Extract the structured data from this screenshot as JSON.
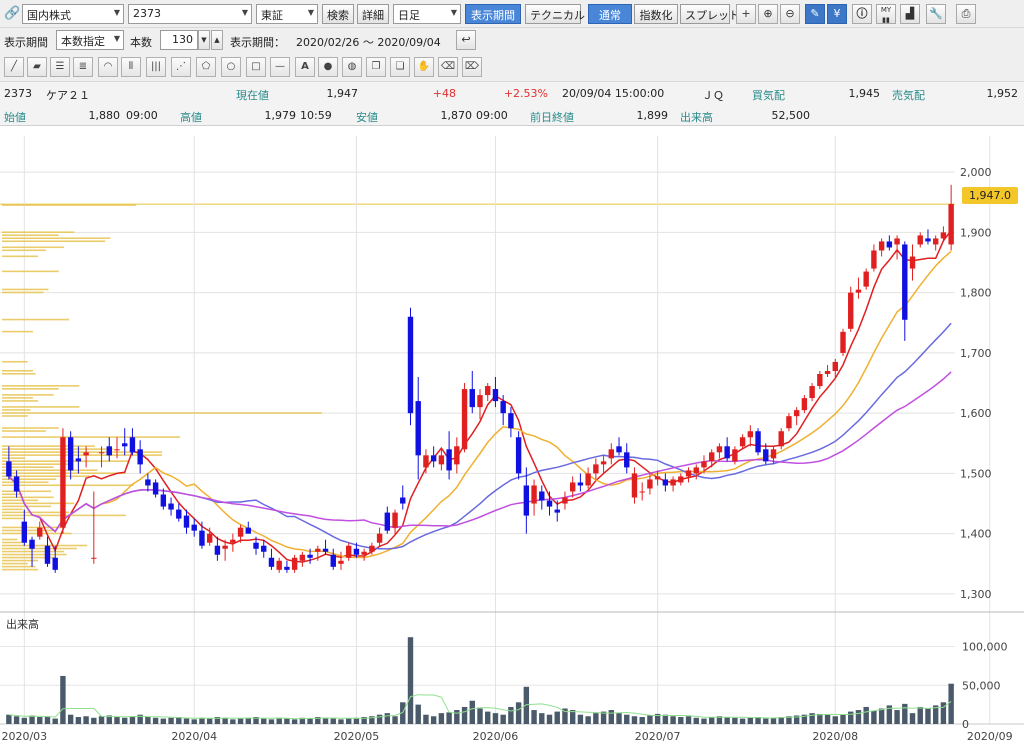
{
  "toolbar": {
    "market_select": "国内株式",
    "code_input": "2373",
    "exchange_select": "東証",
    "search_btn": "検索",
    "detail_btn": "詳細",
    "period_select": "日足",
    "display_period_btn": "表示期間",
    "technical_btn": "テクニカル",
    "normal_btn": "通常",
    "index_btn": "指数化",
    "spread_btn": "スプレッド",
    "icons": [
      "crosshair-icon",
      "zoom-in-icon",
      "zoom-out-icon",
      "pencil-icon",
      "yen-icon",
      "info-icon",
      "my-icon",
      "area-chart-icon",
      "wrench-icon",
      "print-icon"
    ]
  },
  "period_bar": {
    "label": "表示期間",
    "mode_select": "本数指定",
    "count_label": "本数",
    "count_value": "130",
    "range_label": "表示期間：",
    "range_value": "2020/02/26 ～ 2020/09/04"
  },
  "drawing_tools": [
    "line",
    "eraser",
    "list",
    "list2",
    "fan",
    "vertical-lines",
    "fibonacci",
    "pentagon",
    "circle",
    "rectangle",
    "horizontal-line",
    "text",
    "icon",
    "copy",
    "copy2",
    "hand",
    "erase",
    "erase-all"
  ],
  "quote": {
    "code": "2373",
    "name": "ケア２１",
    "current_label": "現在値",
    "current_value": "1,947",
    "change": "+48",
    "change_pct": "+2.53%",
    "datetime": "20/09/04 15:00:00",
    "market": "ＪＱ",
    "bid_label": "買気配",
    "bid_value": "1,945",
    "ask_label": "売気配",
    "ask_value": "1,952",
    "open_label": "始値",
    "open_value": "1,880",
    "open_time": "09:00",
    "high_label": "高値",
    "high_value": "1,979",
    "high_time": "10:59",
    "low_label": "安値",
    "low_value": "1,870",
    "low_time": "09:00",
    "prev_close_label": "前日終値",
    "prev_close_value": "1,899",
    "volume_label": "出来高",
    "volume_value": "52,500"
  },
  "chart_data": {
    "type": "candlestick",
    "price_axis": {
      "ticks": [
        "2,000",
        "1,900",
        "1,800",
        "1,700",
        "1,600",
        "1,500",
        "1,400",
        "1,300"
      ],
      "ylim": [
        1270,
        2060
      ]
    },
    "current_price_label": "1,947.0",
    "volume_title": "出来高",
    "volume_axis": {
      "ticks": [
        "100,000",
        "50,000",
        "0"
      ],
      "ylim": [
        0,
        120000
      ]
    },
    "x_labels": [
      "2020/03",
      "2020/04",
      "2020/05",
      "2020/06",
      "2020/07",
      "2020/08",
      "2020/09"
    ],
    "candles": [
      [
        1520,
        1545,
        1490,
        1495
      ],
      [
        1495,
        1505,
        1460,
        1470
      ],
      [
        1420,
        1440,
        1380,
        1385
      ],
      [
        1390,
        1395,
        1345,
        1375
      ],
      [
        1395,
        1420,
        1390,
        1410
      ],
      [
        1380,
        1395,
        1345,
        1350
      ],
      [
        1360,
        1380,
        1335,
        1340
      ],
      [
        1410,
        1575,
        1400,
        1560
      ],
      [
        1560,
        1570,
        1490,
        1505
      ],
      [
        1525,
        1545,
        1500,
        1520
      ],
      [
        1530,
        1545,
        1510,
        1535
      ],
      [
        1360,
        1470,
        1350,
        1360
      ],
      [
        1535,
        1545,
        1510,
        1535
      ],
      [
        1545,
        1560,
        1520,
        1530
      ],
      [
        1540,
        1560,
        1525,
        1540
      ],
      [
        1550,
        1575,
        1530,
        1545
      ],
      [
        1560,
        1575,
        1530,
        1535
      ],
      [
        1540,
        1555,
        1500,
        1515
      ],
      [
        1490,
        1500,
        1470,
        1480
      ],
      [
        1485,
        1490,
        1460,
        1465
      ],
      [
        1465,
        1475,
        1440,
        1445
      ],
      [
        1450,
        1460,
        1430,
        1440
      ],
      [
        1440,
        1450,
        1420,
        1425
      ],
      [
        1430,
        1440,
        1400,
        1410
      ],
      [
        1415,
        1425,
        1395,
        1405
      ],
      [
        1405,
        1420,
        1375,
        1380
      ],
      [
        1385,
        1410,
        1380,
        1400
      ],
      [
        1380,
        1395,
        1355,
        1365
      ],
      [
        1375,
        1390,
        1355,
        1380
      ],
      [
        1385,
        1400,
        1370,
        1390
      ],
      [
        1395,
        1415,
        1385,
        1410
      ],
      [
        1410,
        1420,
        1400,
        1400
      ],
      [
        1385,
        1395,
        1365,
        1375
      ],
      [
        1380,
        1390,
        1360,
        1370
      ],
      [
        1360,
        1375,
        1340,
        1345
      ],
      [
        1340,
        1360,
        1335,
        1355
      ],
      [
        1345,
        1355,
        1335,
        1340
      ],
      [
        1340,
        1365,
        1335,
        1360
      ],
      [
        1355,
        1370,
        1345,
        1365
      ],
      [
        1365,
        1375,
        1350,
        1360
      ],
      [
        1370,
        1380,
        1355,
        1375
      ],
      [
        1375,
        1390,
        1365,
        1370
      ],
      [
        1365,
        1375,
        1340,
        1345
      ],
      [
        1350,
        1370,
        1340,
        1355
      ],
      [
        1360,
        1385,
        1355,
        1380
      ],
      [
        1375,
        1385,
        1360,
        1365
      ],
      [
        1365,
        1375,
        1355,
        1370
      ],
      [
        1370,
        1385,
        1365,
        1380
      ],
      [
        1385,
        1410,
        1380,
        1400
      ],
      [
        1435,
        1445,
        1400,
        1405
      ],
      [
        1410,
        1440,
        1400,
        1435
      ],
      [
        1460,
        1480,
        1440,
        1450
      ],
      [
        1760,
        1775,
        1580,
        1600
      ],
      [
        1620,
        1660,
        1490,
        1530
      ],
      [
        1510,
        1540,
        1500,
        1530
      ],
      [
        1530,
        1545,
        1510,
        1520
      ],
      [
        1515,
        1540,
        1505,
        1530
      ],
      [
        1540,
        1570,
        1490,
        1505
      ],
      [
        1515,
        1560,
        1500,
        1545
      ],
      [
        1540,
        1650,
        1535,
        1640
      ],
      [
        1640,
        1670,
        1600,
        1610
      ],
      [
        1610,
        1640,
        1590,
        1630
      ],
      [
        1630,
        1650,
        1620,
        1645
      ],
      [
        1640,
        1660,
        1610,
        1620
      ],
      [
        1620,
        1630,
        1580,
        1600
      ],
      [
        1600,
        1610,
        1560,
        1575
      ],
      [
        1560,
        1570,
        1490,
        1500
      ],
      [
        1480,
        1510,
        1400,
        1430
      ],
      [
        1450,
        1490,
        1430,
        1480
      ],
      [
        1470,
        1480,
        1440,
        1455
      ],
      [
        1455,
        1470,
        1430,
        1445
      ],
      [
        1440,
        1455,
        1420,
        1435
      ],
      [
        1450,
        1470,
        1440,
        1460
      ],
      [
        1470,
        1495,
        1460,
        1485
      ],
      [
        1485,
        1500,
        1470,
        1480
      ],
      [
        1480,
        1510,
        1475,
        1500
      ],
      [
        1500,
        1525,
        1490,
        1515
      ],
      [
        1515,
        1530,
        1500,
        1520
      ],
      [
        1525,
        1550,
        1515,
        1540
      ],
      [
        1545,
        1560,
        1530,
        1535
      ],
      [
        1535,
        1550,
        1500,
        1510
      ],
      [
        1460,
        1510,
        1450,
        1500
      ],
      [
        1470,
        1485,
        1455,
        1470
      ],
      [
        1475,
        1500,
        1465,
        1490
      ],
      [
        1490,
        1505,
        1480,
        1495
      ],
      [
        1490,
        1500,
        1470,
        1480
      ],
      [
        1480,
        1495,
        1470,
        1490
      ],
      [
        1485,
        1500,
        1480,
        1495
      ],
      [
        1495,
        1510,
        1485,
        1505
      ],
      [
        1500,
        1515,
        1490,
        1510
      ],
      [
        1510,
        1530,
        1500,
        1520
      ],
      [
        1520,
        1540,
        1510,
        1535
      ],
      [
        1535,
        1550,
        1525,
        1545
      ],
      [
        1545,
        1560,
        1520,
        1525
      ],
      [
        1520,
        1545,
        1515,
        1540
      ],
      [
        1545,
        1565,
        1540,
        1560
      ],
      [
        1560,
        1580,
        1545,
        1570
      ],
      [
        1570,
        1575,
        1530,
        1535
      ],
      [
        1540,
        1550,
        1515,
        1520
      ],
      [
        1525,
        1545,
        1515,
        1540
      ],
      [
        1545,
        1575,
        1540,
        1570
      ],
      [
        1575,
        1600,
        1570,
        1595
      ],
      [
        1595,
        1610,
        1580,
        1605
      ],
      [
        1605,
        1630,
        1600,
        1625
      ],
      [
        1625,
        1650,
        1620,
        1645
      ],
      [
        1645,
        1670,
        1640,
        1665
      ],
      [
        1665,
        1680,
        1660,
        1670
      ],
      [
        1670,
        1690,
        1660,
        1685
      ],
      [
        1700,
        1740,
        1695,
        1735
      ],
      [
        1740,
        1810,
        1735,
        1800
      ],
      [
        1800,
        1825,
        1790,
        1805
      ],
      [
        1810,
        1840,
        1805,
        1835
      ],
      [
        1840,
        1880,
        1835,
        1870
      ],
      [
        1870,
        1890,
        1860,
        1885
      ],
      [
        1885,
        1895,
        1870,
        1875
      ],
      [
        1880,
        1895,
        1855,
        1890
      ],
      [
        1880,
        1885,
        1720,
        1755
      ],
      [
        1840,
        1880,
        1820,
        1860
      ],
      [
        1880,
        1900,
        1875,
        1895
      ],
      [
        1890,
        1905,
        1880,
        1885
      ],
      [
        1880,
        1895,
        1870,
        1890
      ],
      [
        1890,
        1910,
        1885,
        1900
      ],
      [
        1880,
        1979,
        1870,
        1947
      ]
    ],
    "volumes": [
      12,
      10,
      8,
      11,
      9,
      10,
      7,
      62,
      12,
      9,
      10,
      8,
      10,
      11,
      9,
      8,
      10,
      12,
      9,
      8,
      7,
      8,
      9,
      7,
      6,
      8,
      7,
      9,
      8,
      6,
      7,
      8,
      9,
      7,
      6,
      8,
      7,
      6,
      8,
      7,
      9,
      8,
      7,
      6,
      7,
      8,
      9,
      10,
      12,
      14,
      10,
      28,
      112,
      25,
      12,
      10,
      14,
      15,
      18,
      22,
      30,
      20,
      16,
      14,
      12,
      22,
      28,
      48,
      18,
      14,
      12,
      16,
      20,
      18,
      12,
      10,
      14,
      16,
      18,
      14,
      12,
      10,
      9,
      11,
      13,
      12,
      10,
      9,
      10,
      8,
      7,
      9,
      10,
      9,
      8,
      7,
      8,
      9,
      7,
      8,
      9,
      10,
      11,
      12,
      14,
      13,
      12,
      10,
      12,
      16,
      18,
      22,
      17,
      20,
      24,
      18,
      26,
      14,
      22,
      20,
      24,
      28,
      52
    ],
    "ma_short_color": "#e02020",
    "ma_mid_color": "#f0b030",
    "ma_long_color": "#6a6ae0",
    "ma_longest_color": "#c050e0",
    "up_color": "#e02020",
    "down_color": "#1010e0",
    "volume_color": "#4a5a6a"
  }
}
